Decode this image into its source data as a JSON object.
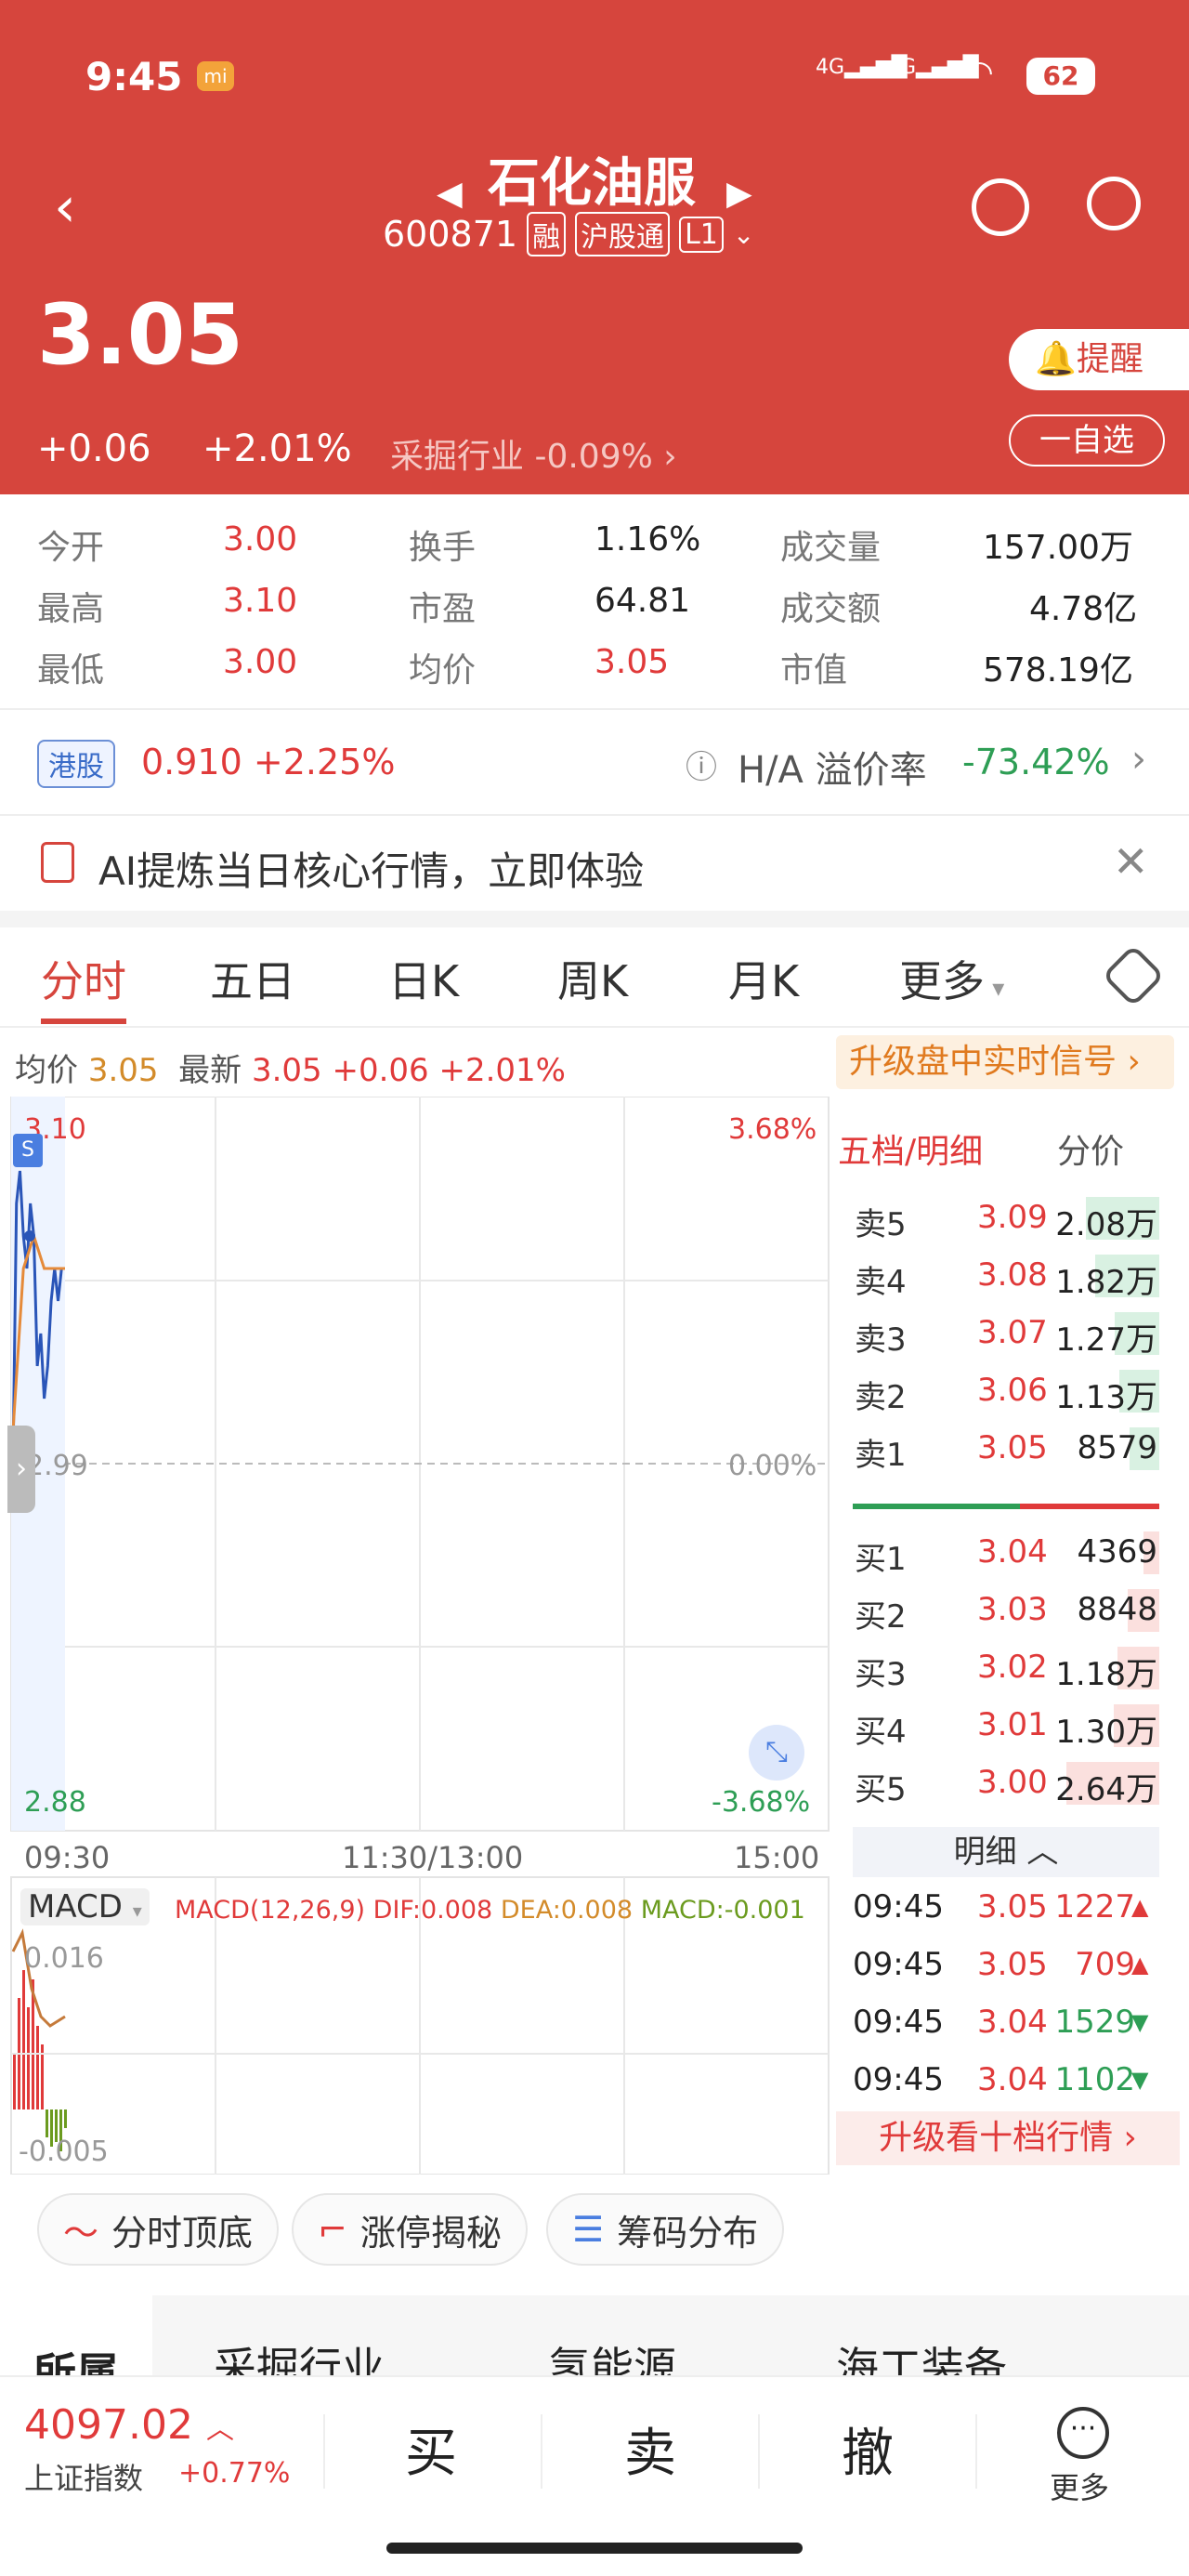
{
  "status": {
    "time": "9:45",
    "sig1": "4G",
    "sig2": "4G",
    "battery": "62"
  },
  "stock": {
    "name": "石化油服",
    "code": "600871",
    "tag1": "融",
    "tag2": "沪股通",
    "tag3": "L1",
    "price": "3.05",
    "change": "+0.06",
    "pct": "+2.01%",
    "industry": "采掘行业",
    "industry_pct": "-0.09%",
    "remind": "提醒",
    "watch": "一自选"
  },
  "stats": [
    {
      "l": "今开",
      "v": "3.00",
      "l2": "换手",
      "v2": "1.16%",
      "l3": "成交量",
      "v3": "157.00万"
    },
    {
      "l": "最高",
      "v": "3.10",
      "l2": "市盈",
      "v2": "64.81",
      "l3": "成交额",
      "v3": "4.78亿"
    },
    {
      "l": "最低",
      "v": "3.00",
      "l2": "均价",
      "v2": "3.05",
      "l3": "市值",
      "v3": "578.19亿"
    }
  ],
  "hk": {
    "badge": "港股",
    "price": "0.910",
    "pct": "+2.25%",
    "label": "H/A 溢价率",
    "value": "-73.42%"
  },
  "ai": {
    "text": "AI提炼当日核心行情，立即体验"
  },
  "tabs": [
    "分时",
    "五日",
    "日K",
    "周K",
    "月K",
    "更多"
  ],
  "quote": {
    "avg_label": "均价",
    "avg": "3.05",
    "last_label": "最新",
    "last": "3.05",
    "chg": "+0.06",
    "pct": "+2.01%",
    "upgrade": "升级盘中实时信号"
  },
  "chart_data": {
    "type": "line",
    "title": "",
    "x_ticks": [
      "09:30",
      "11:30/13:00",
      "15:00"
    ],
    "ylim": [
      2.88,
      3.1
    ],
    "base": 2.99,
    "left_ticks": [
      "3.10",
      "2.99",
      "2.88"
    ],
    "right_ticks": [
      "3.68%",
      "0.00%",
      "-3.68%"
    ],
    "series": [
      {
        "name": "",
        "x": [
          "09:30",
          "09:31",
          "09:32",
          "09:33",
          "09:34",
          "09:35",
          "09:36",
          "09:37",
          "09:38",
          "09:39",
          "09:40",
          "09:41",
          "09:42",
          "09:43",
          "09:44",
          "09:45"
        ],
        "y": [
          2.99,
          3.07,
          3.08,
          3.06,
          3.05,
          3.07,
          3.06,
          3.02,
          3.03,
          3.01,
          3.02,
          3.04,
          3.05,
          3.04,
          3.05,
          3.05
        ]
      },
      {
        "name": "",
        "x": [
          "09:30",
          "09:33",
          "09:36",
          "09:39",
          "09:42",
          "09:45"
        ],
        "y": [
          3.0,
          3.05,
          3.06,
          3.05,
          3.05,
          3.05
        ]
      }
    ],
    "macd": {
      "label": "MACD",
      "params": "MACD(12,26,9)",
      "dif": "DIF:0.008",
      "dea": "DEA:0.008",
      "macd": "MACD:-0.001",
      "top": "0.016",
      "bottom": "-0.005"
    }
  },
  "book": {
    "title": "五档/明细",
    "sub": "分价",
    "sells": [
      {
        "l": "卖5",
        "p": "3.09",
        "v": "2.08万"
      },
      {
        "l": "卖4",
        "p": "3.08",
        "v": "1.82万"
      },
      {
        "l": "卖3",
        "p": "3.07",
        "v": "1.27万"
      },
      {
        "l": "卖2",
        "p": "3.06",
        "v": "1.13万"
      },
      {
        "l": "卖1",
        "p": "3.05",
        "v": "8579"
      }
    ],
    "buys": [
      {
        "l": "买1",
        "p": "3.04",
        "v": "4369"
      },
      {
        "l": "买2",
        "p": "3.03",
        "v": "8848"
      },
      {
        "l": "买3",
        "p": "3.02",
        "v": "1.18万"
      },
      {
        "l": "买4",
        "p": "3.01",
        "v": "1.30万"
      },
      {
        "l": "买5",
        "p": "3.00",
        "v": "2.64万"
      }
    ],
    "detail": "明细",
    "trades": [
      {
        "t": "09:45",
        "p": "3.05",
        "v": "1227"
      },
      {
        "t": "09:45",
        "p": "3.05",
        "v": "709"
      },
      {
        "t": "09:45",
        "p": "3.04",
        "v": "1529"
      },
      {
        "t": "09:45",
        "p": "3.04",
        "v": "1102"
      }
    ],
    "upgrade": "升级看十档行情"
  },
  "tools": [
    "分时顶底",
    "涨停揭秘",
    "筹码分布"
  ],
  "sectors": {
    "label": "所属",
    "items": [
      "采掘行业",
      "氢能源",
      "海工装备"
    ]
  },
  "bottom": {
    "index": "4097.02",
    "index_name": "上证指数",
    "index_pct": "+0.77%",
    "buy": "买",
    "sell": "卖",
    "cancel": "撤",
    "more": "更多"
  },
  "colors": {
    "header": "#d6453d",
    "up": "#e03a3a",
    "down": "#2e9e55"
  }
}
